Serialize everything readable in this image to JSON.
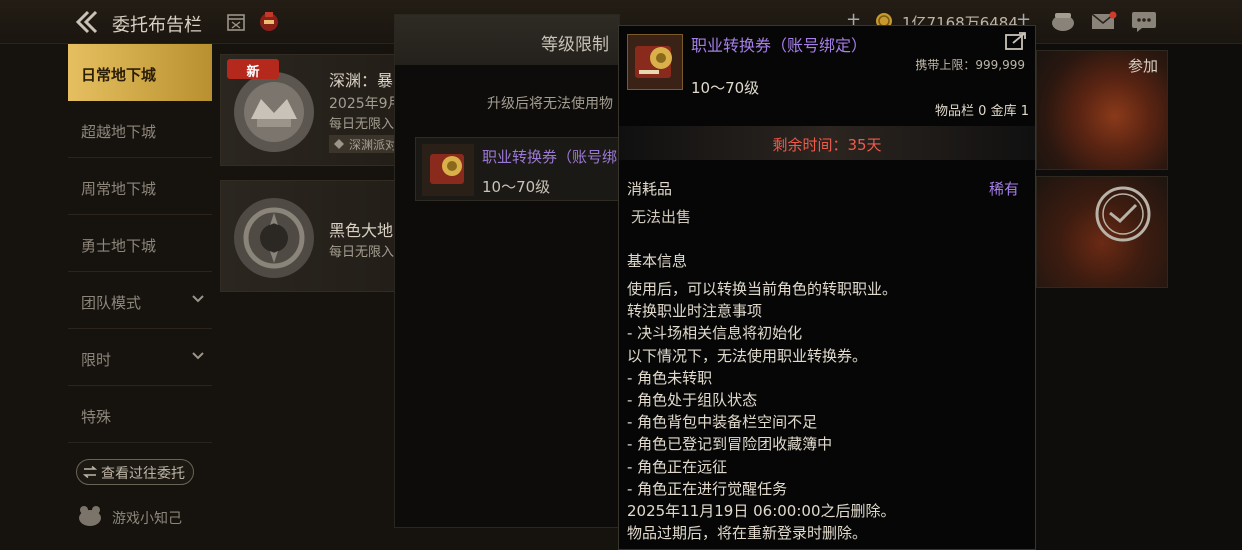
{
  "header": {
    "title": "委托布告栏",
    "currency": "1亿7168万6484"
  },
  "sidebar": {
    "items": [
      {
        "label": "日常地下城"
      },
      {
        "label": "超越地下城"
      },
      {
        "label": "周常地下城"
      },
      {
        "label": "勇士地下城"
      },
      {
        "label": "团队模式"
      },
      {
        "label": "限时"
      },
      {
        "label": "特殊"
      }
    ],
    "history_button": "查看过往委托",
    "knowledge": "游戏小知己"
  },
  "cards": [
    {
      "badge": "新",
      "title": "深渊：暴",
      "date": "2025年9月",
      "limit": "每日无限入",
      "tag": "深渊派对"
    },
    {
      "title": "黑色大地",
      "limit": "每日无限入"
    }
  ],
  "dialog": {
    "title": "等级限制",
    "description": "升级后将无法使用物",
    "item_name": "职业转换券（账号绑",
    "item_level": "10～70级"
  },
  "right_panel": {
    "join_label": "参加"
  },
  "tooltip": {
    "name": "职业转换券（账号绑定）",
    "carry_limit": "携带上限：999,999",
    "level": "10～70级",
    "storage": "物品栏 0 金库 1",
    "remaining": "剩余时间：35天",
    "type": "消耗品",
    "rarity": "稀有",
    "sell": "无法出售",
    "section_title": "基本信息",
    "lines": [
      "使用后，可以转换当前角色的转职职业。",
      "转换职业时注意事项",
      "- 决斗场相关信息将初始化",
      "以下情况下，无法使用职业转换券。",
      "- 角色未转职",
      "- 角色处于组队状态",
      "- 角色背包中装备栏空间不足",
      "- 角色已登记到冒险团收藏簿中",
      "- 角色正在远征",
      "- 角色正在进行觉醒任务",
      "2025年11月19日 06:00:00之后删除。",
      "物品过期后，将在重新登录时删除。"
    ]
  },
  "colors": {
    "accent_gold": "#e6c060",
    "rare_purple": "#a57ee8",
    "time_red": "#ef5a4a",
    "new_badge_red": "#b5281c"
  }
}
